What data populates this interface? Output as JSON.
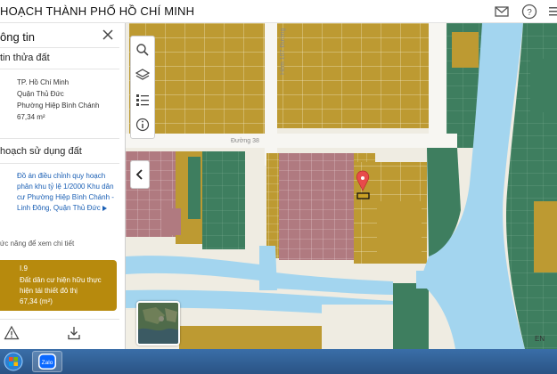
{
  "header": {
    "title": "HOẠCH THÀNH PHỐ HỒ CHÍ MINH",
    "icons": [
      "mail-icon",
      "help-icon",
      "menu-icon"
    ]
  },
  "panel": {
    "title": "ông tin",
    "parcel_section": "tin thửa đất",
    "parcel": {
      "city": "TP. Hồ Chí Minh",
      "district": "Quận Thủ Đức",
      "ward": "Phường Hiệp Bình Chánh",
      "area": "67,34 m²"
    },
    "planning_section": "hoạch sử dụng đất",
    "plan_link": "Đồ án điều chỉnh quy hoạch phân khu tỷ lệ 1/2000 Khu dân cư Phường Hiệp Bình Chánh - Linh Đông, Quận Thủ Đức",
    "hint": "ức năng để xem chi tiết",
    "land": {
      "code": "I.9",
      "description": "Đất dân cư hiện hữu thực hiện tái thiết đô thị",
      "area": "67,34 (m²)"
    }
  },
  "map": {
    "road_label_1": "Đường 38",
    "road_label_2": "Hẻm 107 Đường",
    "tools": [
      "search-icon",
      "layers-icon",
      "legend-icon",
      "info-icon"
    ]
  },
  "taskbar": {
    "app": "Zalo",
    "lang": "EN"
  },
  "colors": {
    "residential": "#bd9a32",
    "green": "#3e7e5f",
    "pink": "#b07a80",
    "water": "#a3d5ef",
    "card": "#b78a0d"
  }
}
